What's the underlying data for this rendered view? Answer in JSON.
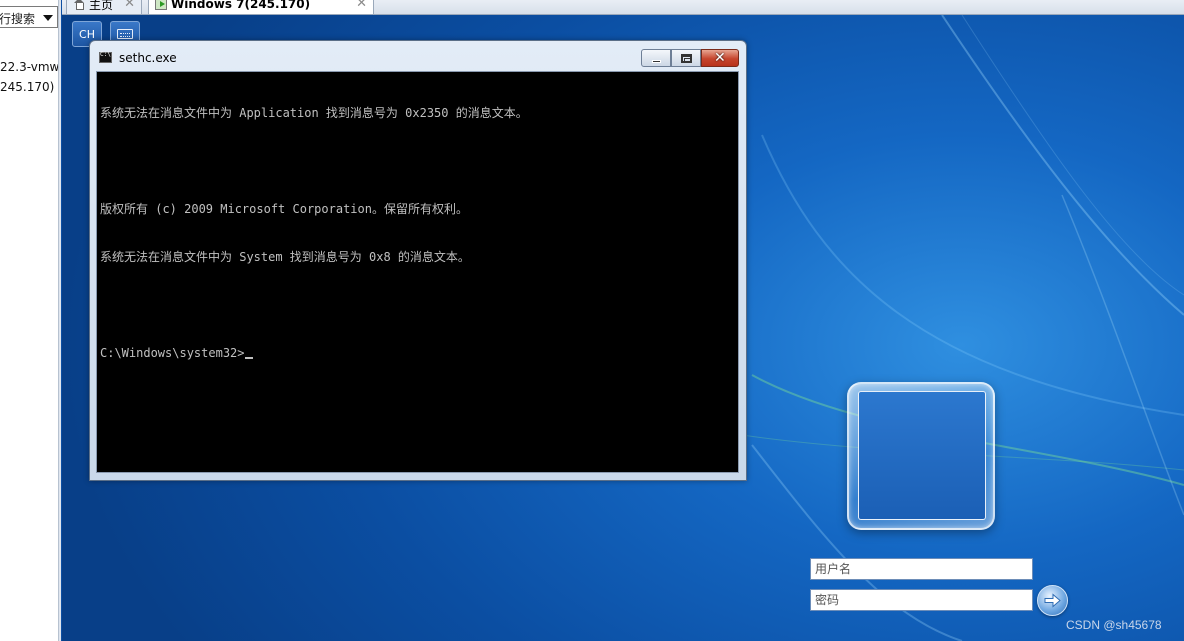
{
  "sidebar": {
    "search_text": "行搜索",
    "lines": [
      "22.3-vmw",
      "245.170)"
    ]
  },
  "tabs": [
    {
      "label": "主页",
      "icon": "home-icon"
    },
    {
      "label": "Windows 7(245.170)",
      "icon": "vm-icon"
    }
  ],
  "vm_toolbar": {
    "lang_label": "CH",
    "keyboard_icon": "keyboard-icon"
  },
  "cmd": {
    "title": "sethc.exe",
    "close_glyph": "✕",
    "lines": [
      "系统无法在消息文件中为 Application 找到消息号为 0x2350 的消息文本。",
      "",
      "版权所有 (c) 2009 Microsoft Corporation。保留所有权利。",
      "系统无法在消息文件中为 System 找到消息号为 0x8 的消息文本。",
      "",
      "C:\\Windows\\system32>"
    ]
  },
  "login": {
    "username_placeholder": "用户名",
    "password_placeholder": "密码",
    "submit_icon": "arrow-right-icon"
  },
  "watermark": "CSDN @sh45678",
  "colors": {
    "desktop_blue": "#0d4fa3",
    "console_bg": "#000000",
    "console_text": "#c0c0c0",
    "close_red": "#c6452d"
  }
}
